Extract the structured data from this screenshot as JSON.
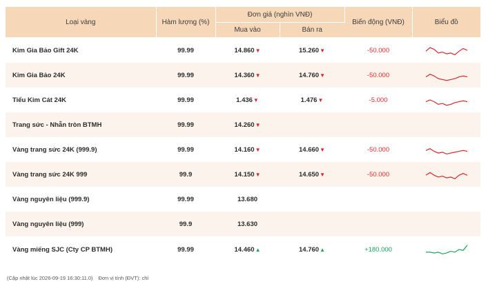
{
  "table": {
    "headers": {
      "type": "Loại vàng",
      "purity": "Hàm lượng (%)",
      "price_group": "Đơn giá (nghìn VNĐ)",
      "buy": "Mua vào",
      "sell": "Bán ra",
      "change": "Biến động (VNĐ)",
      "chart": "Biểu đồ"
    },
    "rows": [
      {
        "name": "Kim Gia Bảo Gift 24K",
        "purity": "99.99",
        "buy": "14.860",
        "buy_dir": "down",
        "sell": "15.260",
        "sell_dir": "down",
        "change": "-50.000",
        "trend": "down",
        "spark": [
          8,
          4,
          6,
          10,
          9,
          11,
          10,
          12,
          8,
          5,
          7
        ]
      },
      {
        "name": "Kim Gia Bảo 24K",
        "purity": "99.99",
        "buy": "14.360",
        "buy_dir": "down",
        "sell": "14.760",
        "sell_dir": "down",
        "change": "-50.000",
        "trend": "down",
        "spark": [
          9,
          6,
          8,
          11,
          12,
          13,
          12,
          11,
          9,
          8,
          9
        ]
      },
      {
        "name": "Tiểu Kim Cát 24K",
        "purity": "99.99",
        "buy": "1.436",
        "buy_dir": "down",
        "sell": "1.476",
        "sell_dir": "down",
        "change": "-5.000",
        "trend": "down",
        "spark": [
          9,
          7,
          9,
          12,
          11,
          13,
          12,
          10,
          9,
          8,
          9
        ]
      },
      {
        "name": "Trang sức - Nhẫn tròn BTMH",
        "purity": "99.99",
        "buy": "14.260",
        "buy_dir": "down",
        "sell": "",
        "sell_dir": "",
        "change": "",
        "trend": "",
        "spark": []
      },
      {
        "name": "Vàng trang sức 24K (999.9)",
        "purity": "99.99",
        "buy": "14.160",
        "buy_dir": "down",
        "sell": "14.660",
        "sell_dir": "down",
        "change": "-50.000",
        "trend": "down",
        "spark": [
          8,
          6,
          9,
          11,
          10,
          12,
          11,
          10,
          9,
          8,
          9
        ]
      },
      {
        "name": "Vàng trang sức 24K 999",
        "purity": "99.9",
        "buy": "14.150",
        "buy_dir": "down",
        "sell": "14.650",
        "sell_dir": "down",
        "change": "-50.000",
        "trend": "down",
        "spark": [
          8,
          5,
          8,
          10,
          9,
          11,
          10,
          12,
          8,
          6,
          8
        ]
      },
      {
        "name": "Vàng nguyên liệu (999.9)",
        "purity": "99.99",
        "buy": "13.680",
        "buy_dir": "",
        "sell": "",
        "sell_dir": "",
        "change": "",
        "trend": "",
        "spark": []
      },
      {
        "name": "Vàng nguyên liệu (999)",
        "purity": "99.9",
        "buy": "13.630",
        "buy_dir": "",
        "sell": "",
        "sell_dir": "",
        "change": "",
        "trend": "",
        "spark": []
      },
      {
        "name": "Vàng miếng SJC (Cty CP BTMH)",
        "purity": "99.99",
        "buy": "14.460",
        "buy_dir": "up",
        "sell": "14.760",
        "sell_dir": "up",
        "change": "+180.000",
        "trend": "up",
        "spark": [
          10,
          10,
          11,
          10,
          12,
          11,
          9,
          10,
          7,
          8,
          2
        ]
      }
    ]
  },
  "footer": {
    "updated": "(Cập nhật lúc 2026-09-19 16:30:11.0)",
    "unit": "Đơn vị tính (ĐVT): chỉ"
  },
  "colors": {
    "header_bg": "#f6d7b8",
    "row_alt_bg": "#fcf4ec",
    "down": "#d8262a",
    "up": "#1aa35a"
  },
  "icons": {
    "down": "triangle-down-icon",
    "up": "triangle-up-icon"
  }
}
